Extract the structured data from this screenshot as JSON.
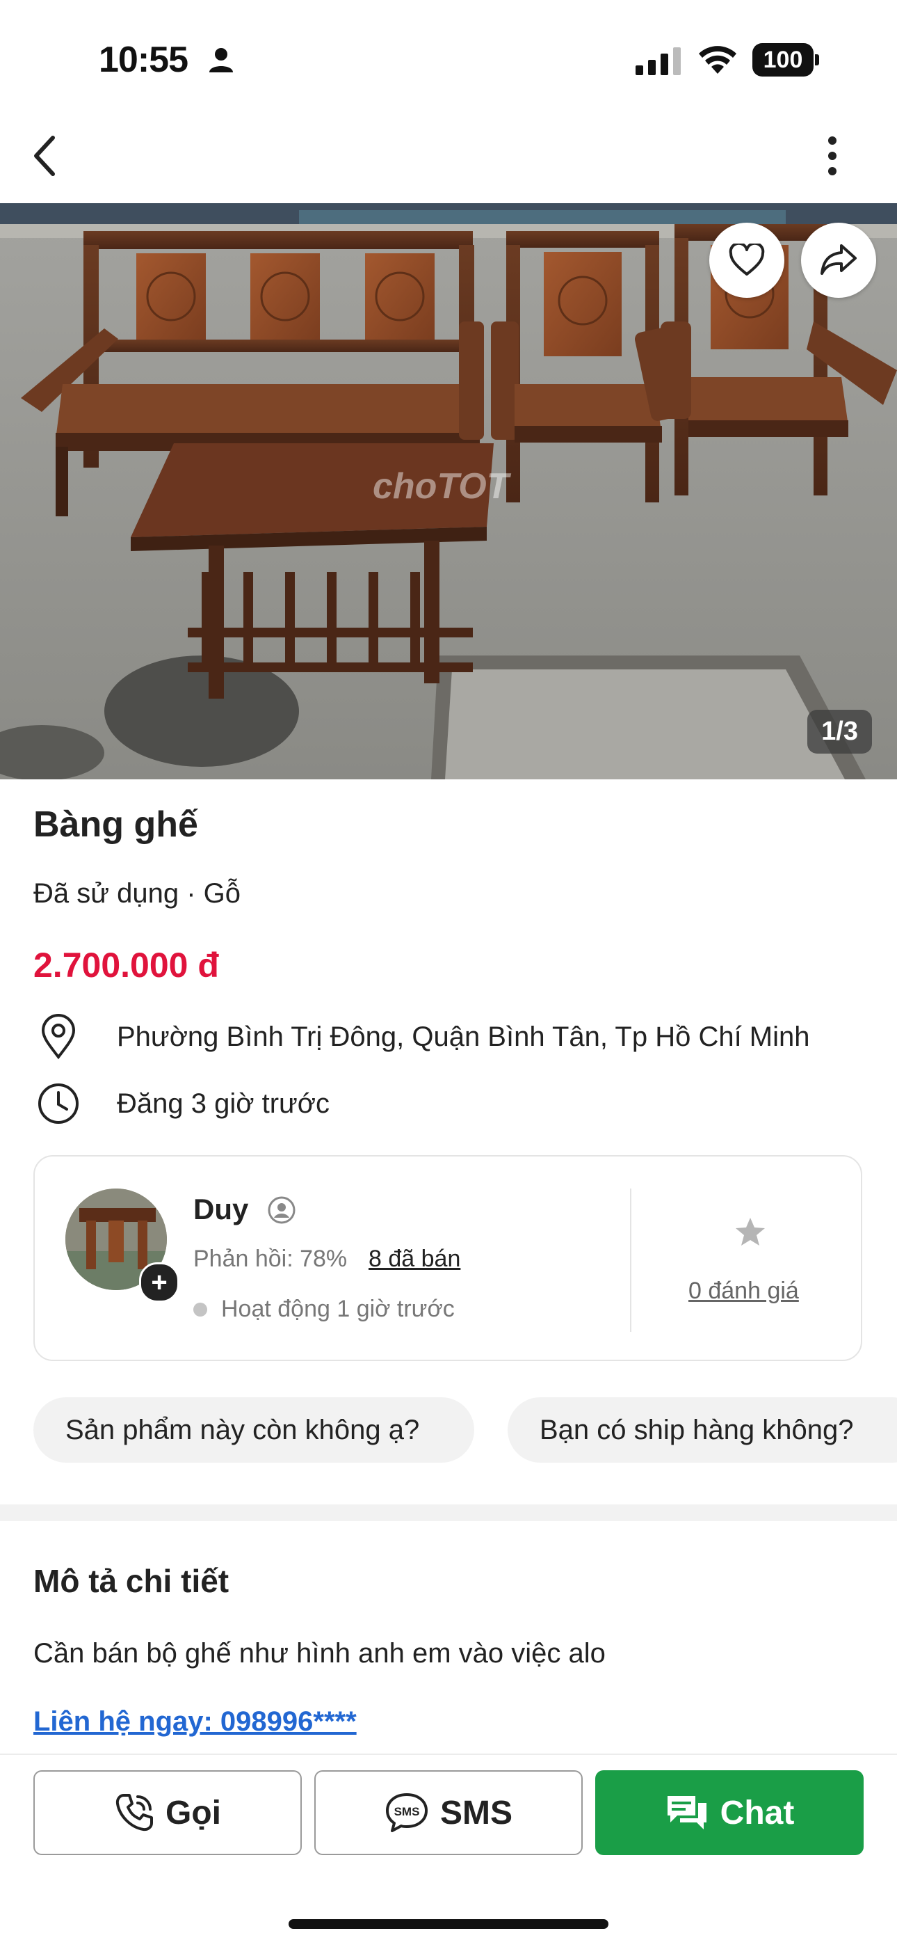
{
  "status_bar": {
    "time": "10:55",
    "battery": "100"
  },
  "listing": {
    "photo_counter": "1/3",
    "watermark": "choTOT",
    "title": "Bàng ghế",
    "subtitle": "Đã sử dụng · Gỗ",
    "price": "2.700.000 đ",
    "location": "Phường Bình Trị Đông, Quận Bình Tân, Tp Hồ Chí Minh",
    "posted": "Đăng 3 giờ trước"
  },
  "seller": {
    "name": "Duy",
    "reply_rate": "Phản hồi: 78%",
    "sold": "8 đã bán",
    "active": "Hoạt động 1 giờ trước",
    "rating": "0 đánh giá"
  },
  "quick_questions": [
    "Sản phẩm này còn không ạ?",
    "Bạn có ship hàng không?"
  ],
  "description": {
    "heading": "Mô tả chi tiết",
    "text": "Cần bán bộ ghế như hình anh em vào việc alo",
    "contact": "Liên hệ ngay: 098996****"
  },
  "actions": {
    "call": "Gọi",
    "sms": "SMS",
    "chat": "Chat"
  },
  "colors": {
    "price": "#e0133c",
    "chat": "#1a9e47",
    "link": "#2267d2"
  },
  "icons": [
    "person-icon",
    "signal-icon",
    "wifi-icon",
    "battery-icon",
    "back-icon",
    "more-icon",
    "heart-icon",
    "share-icon",
    "location-icon",
    "clock-icon",
    "verified-icon",
    "star-icon",
    "phone-icon",
    "sms-icon",
    "chat-icon"
  ]
}
